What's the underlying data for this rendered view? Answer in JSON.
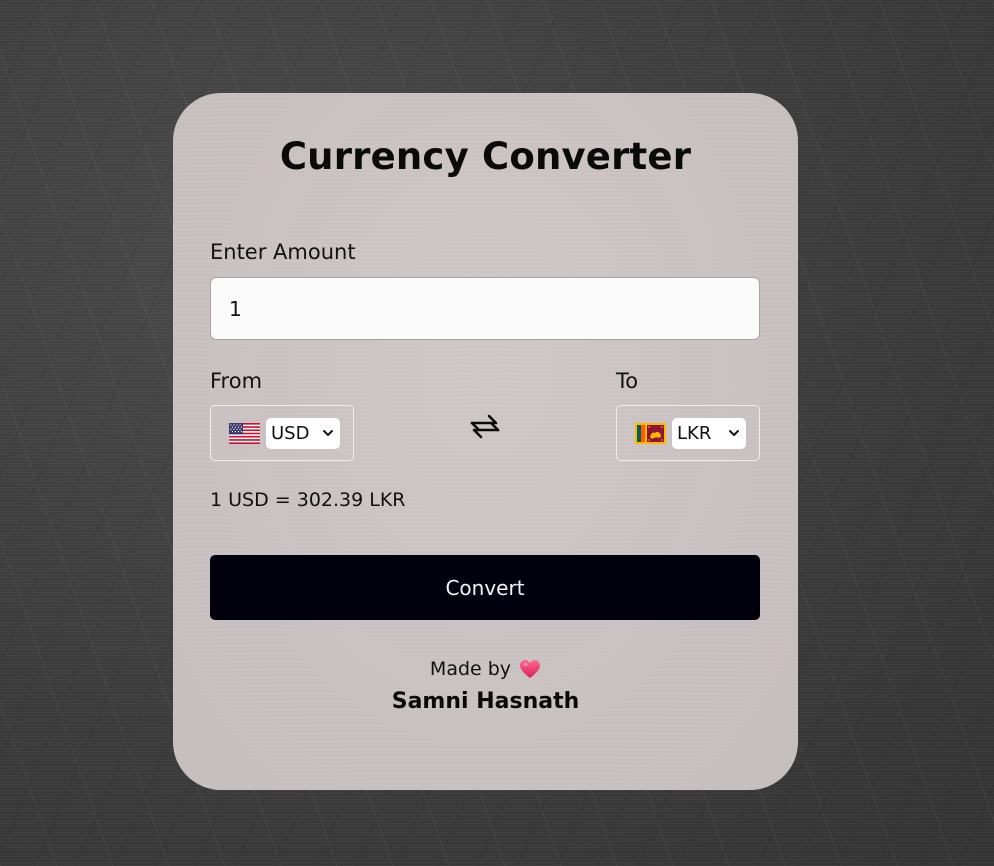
{
  "app": {
    "title": "Currency Converter"
  },
  "amount": {
    "label": "Enter Amount",
    "value": "1"
  },
  "from": {
    "label": "From",
    "flag_icon": "us-flag-icon",
    "selected": "USD"
  },
  "to": {
    "label": "To",
    "flag_icon": "lk-flag-icon",
    "selected": "LKR"
  },
  "swap": {
    "icon": "swap-arrows-icon"
  },
  "rate_text": "1 USD = 302.39 LKR",
  "convert_label": "Convert",
  "footer": {
    "made_by": "Made by",
    "heart_icon": "heart-icon",
    "author": "Samni Hasnath"
  },
  "colors": {
    "card": "#c9c1c1",
    "button": "#02020f",
    "heart": "#e8336a"
  }
}
